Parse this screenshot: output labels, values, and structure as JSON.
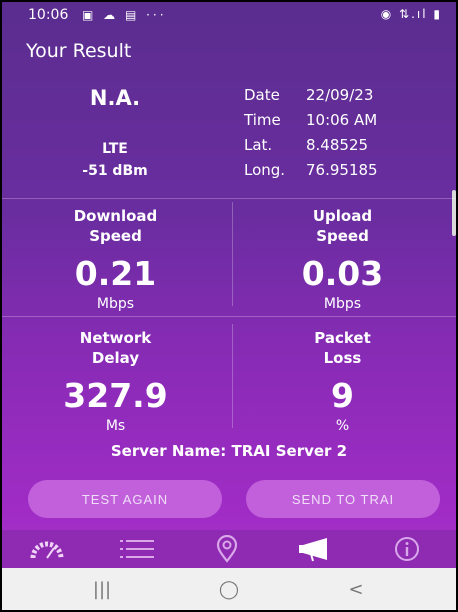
{
  "status_bar": {
    "time": "10:06",
    "left_icons": "▣ ☁ ▤ ···",
    "right_icons": "◉ ⇅.ıl ▮"
  },
  "app_title": "Your Result",
  "network": {
    "operator": "N.A.",
    "technology": "LTE",
    "signal": "-51 dBm"
  },
  "info": [
    {
      "key": "Date",
      "value": "22/09/23"
    },
    {
      "key": "Time",
      "value": "10:06 AM"
    },
    {
      "key": "Lat.",
      "value": "8.48525"
    },
    {
      "key": "Long.",
      "value": "76.95185"
    }
  ],
  "metrics": {
    "download": {
      "label_line1": "Download",
      "label_line2": "Speed",
      "value": "0.21",
      "unit": "Mbps"
    },
    "upload": {
      "label_line1": "Upload",
      "label_line2": "Speed",
      "value": "0.03",
      "unit": "Mbps"
    },
    "delay": {
      "label_line1": "Network",
      "label_line2": "Delay",
      "value": "327.9",
      "unit": "Ms"
    },
    "loss": {
      "label_line1": "Packet",
      "label_line2": "Loss",
      "value": "9",
      "unit": "%"
    }
  },
  "server_name": "Server Name: TRAI Server 2",
  "buttons": {
    "test_again": "TEST AGAIN",
    "send_to_trai": "SEND TO TRAI"
  },
  "tabs": [
    "speedometer-icon",
    "list-icon",
    "location-pin-icon",
    "megaphone-icon",
    "info-icon"
  ],
  "colors": {
    "accent_button": "#c260dc",
    "tabbar": "#8e2bb2",
    "bg_top": "#5b2d8f",
    "bg_bottom": "#a83fcc"
  },
  "nav_bar": {
    "recents": "|||",
    "home": "◯",
    "back": "<"
  }
}
